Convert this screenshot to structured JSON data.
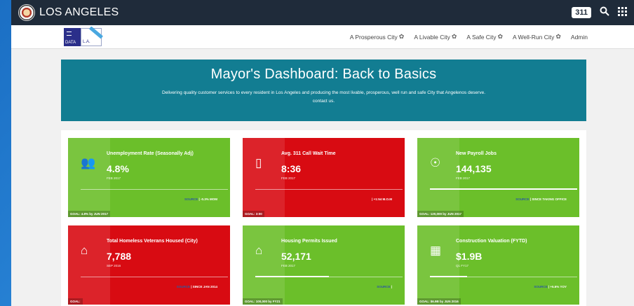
{
  "header": {
    "brand": "LOS ANGELES",
    "badge": "311",
    "icons": [
      "search-icon",
      "apps-grid-icon"
    ]
  },
  "nav": {
    "logo_left": "DATA",
    "logo_right": "L.A.",
    "items": [
      {
        "label": "A Prosperous City",
        "icon": "gear-icon"
      },
      {
        "label": "A Livable City",
        "icon": "gear-icon"
      },
      {
        "label": "A Safe City",
        "icon": "gear-icon"
      },
      {
        "label": "A Well-Run City",
        "icon": "gear-icon"
      },
      {
        "label": "Admin"
      }
    ]
  },
  "hero": {
    "title": "Mayor's Dashboard: Back to Basics",
    "subtitle": "Delivering quality customer services to every resident in Los Angeles and producing the most livable, prosperous, well run and safe City that Angelenos deserve.",
    "contact": "contact us."
  },
  "colors": {
    "green": "#6bbf2a",
    "red": "#d80b12",
    "teal": "#127d92",
    "topbar": "#1f2b3a"
  },
  "cards": [
    {
      "title": "Unemployment Rate (Seasonally Adj)",
      "value": "4.8%",
      "date": "FEB 2017",
      "source": "SOURCE",
      "delta": " | -0.3% MOM",
      "goal": "GOAL: 4.8% by JUN 2017",
      "color": "green",
      "icon": "people-icon",
      "progress": 0
    },
    {
      "title": "Avg. 311 Call Wait Time",
      "value": "8:36",
      "date": "FEB 2017",
      "source": "",
      "delta": "| +1:54 M.O.M",
      "goal": "GOAL: 3:00",
      "color": "red",
      "icon": "phone-icon",
      "progress": 0
    },
    {
      "title": "New Payroll Jobs",
      "value": "144,135",
      "date": "FEB 2017",
      "source": "SOURCE",
      "delta": " | SINCE TAKING OFFICE",
      "goal": "GOAL: 120,000 by JUN 2017",
      "color": "green",
      "icon": "lightbulb-icon",
      "progress": 1.0
    },
    {
      "title": "Total Homeless Veterans Housed (City)",
      "value": "7,788",
      "date": "SEP 2016",
      "source": "SOURCE",
      "delta": " | SINCE JAN 2014",
      "goal": "GOAL:",
      "color": "red",
      "icon": "home-icon",
      "progress": 0
    },
    {
      "title": "Housing Permits Issued",
      "value": "52,171",
      "date": "FEB 2017",
      "source": "SOURCE",
      "delta": " |",
      "goal": "GOAL: 100,000 by FY21",
      "color": "green",
      "icon": "home-icon",
      "progress": 0.5
    },
    {
      "title": "Construction Valuation (FYTD)",
      "value": "$1.9B",
      "date": "Q1 FY17",
      "source": "SOURCE",
      "delta": " | +5.6% YOY",
      "goal": "GOAL: $6.9B by JUN 2016",
      "color": "green",
      "icon": "building-icon",
      "progress": 0.25
    }
  ]
}
